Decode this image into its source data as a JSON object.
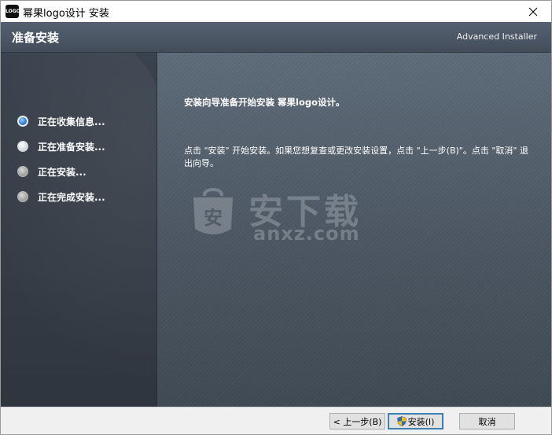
{
  "window": {
    "icon_text": "LOGO",
    "title": "幂果logo设计 安装"
  },
  "header": {
    "title": "准备安装",
    "brand": "Advanced Installer"
  },
  "steps": [
    {
      "label": "正在收集信息...",
      "state": "active"
    },
    {
      "label": "正在准备安装...",
      "state": "pending"
    },
    {
      "label": "正在安装...",
      "state": "disabled"
    },
    {
      "label": "正在完成安装...",
      "state": "disabled"
    }
  ],
  "content": {
    "heading": "安装向导准备开始安装 幂果logo设计。",
    "body": "点击 \"安装\" 开始安装。如果您想复查或更改安装设置，点击 \"上一步(B)\"。点击 \"取消\" 退出向导。"
  },
  "watermark": {
    "big_text": "安下载",
    "small_text": "anxz.com",
    "shield_text": "安"
  },
  "buttons": {
    "back": "< 上一步(B)",
    "install": "安装(I)",
    "cancel": "取消"
  },
  "colors": {
    "header_bg": "#4b5663",
    "steps_bg": "#373e48",
    "content_bg": "#515d69",
    "active_bullet": "#2f7fd3",
    "default_button_border": "#3c7fb1"
  }
}
